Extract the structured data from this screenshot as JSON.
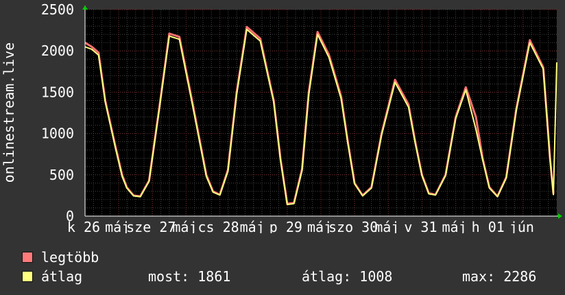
{
  "chart_data": {
    "type": "line",
    "ylabel": "onlinestream.live",
    "ylim": [
      0,
      2500
    ],
    "yticks": [
      "0",
      "500",
      "1000",
      "1500",
      "2000",
      "2500"
    ],
    "xtick_labels": [
      "k 26",
      "máj",
      "sze 27",
      "máj",
      "cs 28",
      "máj",
      "p 29",
      "máj",
      "szo 30",
      "máj",
      "v 31",
      "máj",
      "h 01",
      "jún"
    ],
    "grid": true,
    "colors": {
      "background": "#000000",
      "major_grid": "#7a2a2a",
      "minor_grid": "#4a4a4a",
      "axis": "#ffffff"
    },
    "series": [
      {
        "name": "legtöbb",
        "color": "#ff7070",
        "x": [
          0.0,
          0.1,
          0.2,
          0.3,
          0.45,
          0.55,
          0.62,
          0.72,
          0.82,
          0.95,
          1.1,
          1.25,
          1.4,
          1.6,
          1.8,
          1.9,
          2.0,
          2.12,
          2.25,
          2.4,
          2.6,
          2.8,
          2.9,
          3.0,
          3.1,
          3.22,
          3.32,
          3.45,
          3.62,
          3.8,
          3.9,
          4.0,
          4.12,
          4.25,
          4.4,
          4.6,
          4.8,
          4.9,
          5.0,
          5.1,
          5.2,
          5.35,
          5.5,
          5.65,
          5.8,
          5.9,
          6.0,
          6.12,
          6.25,
          6.4,
          6.6,
          6.8,
          6.9,
          6.95
        ],
        "y": [
          2100,
          2050,
          1980,
          1400,
          850,
          500,
          350,
          250,
          240,
          430,
          1300,
          2210,
          2170,
          1350,
          500,
          300,
          260,
          560,
          1500,
          2290,
          2150,
          1400,
          700,
          150,
          160,
          570,
          1500,
          2230,
          1950,
          1450,
          900,
          400,
          250,
          350,
          1000,
          1650,
          1350,
          900,
          500,
          280,
          260,
          500,
          1200,
          1560,
          1200,
          700,
          350,
          240,
          470,
          1300,
          2130,
          1800,
          700,
          270
        ]
      },
      {
        "name": "átlag",
        "color": "#ffff80",
        "x": [
          0.0,
          0.1,
          0.2,
          0.3,
          0.45,
          0.55,
          0.62,
          0.72,
          0.82,
          0.95,
          1.1,
          1.25,
          1.4,
          1.6,
          1.8,
          1.9,
          2.0,
          2.12,
          2.25,
          2.4,
          2.6,
          2.8,
          2.9,
          3.0,
          3.1,
          3.22,
          3.32,
          3.45,
          3.62,
          3.8,
          3.9,
          4.0,
          4.12,
          4.25,
          4.4,
          4.6,
          4.8,
          4.9,
          5.0,
          5.1,
          5.2,
          5.35,
          5.5,
          5.65,
          5.8,
          5.9,
          6.0,
          6.12,
          6.25,
          6.4,
          6.6,
          6.8,
          6.9,
          6.95
        ],
        "y": [
          2050,
          2020,
          1950,
          1380,
          830,
          480,
          340,
          245,
          235,
          420,
          1280,
          2180,
          2140,
          1320,
          480,
          290,
          255,
          540,
          1470,
          2260,
          2120,
          1380,
          680,
          140,
          150,
          550,
          1470,
          2200,
          1920,
          1420,
          880,
          390,
          245,
          340,
          980,
          1620,
          1320,
          880,
          490,
          270,
          255,
          490,
          1180,
          1530,
          1050,
          680,
          340,
          235,
          460,
          1280,
          2100,
          1780,
          680,
          260
        ]
      }
    ],
    "tail": {
      "x": [
        6.95,
        7.0
      ],
      "y": [
        270,
        1861
      ]
    }
  },
  "legend": {
    "items": [
      {
        "label": "legtöbb",
        "color": "#ff7a7a"
      },
      {
        "label": "átlag",
        "color": "#ffff80"
      }
    ],
    "stats": {
      "most_label": "most: 1861",
      "avg_label": "átlag: 1008",
      "max_label": "max: 2286"
    }
  }
}
